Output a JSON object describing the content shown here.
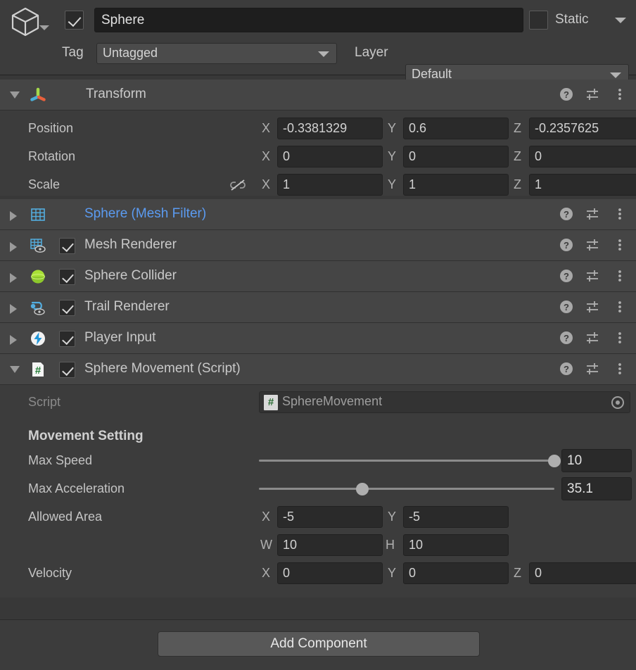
{
  "object_header": {
    "icon": "cube-icon",
    "enabled": true,
    "name": "Sphere",
    "static_enabled": false,
    "static_label": "Static",
    "tag_label": "Tag",
    "tag_value": "Untagged",
    "layer_label": "Layer",
    "layer_value": "Default"
  },
  "transform": {
    "title": "Transform",
    "icon": "transform-gizmo-icon",
    "expanded": true,
    "rows": [
      {
        "label": "Position",
        "x_label": "X",
        "x": "-0.3381329",
        "y_label": "Y",
        "y": "0.6",
        "z_label": "Z",
        "z": "-0.2357625"
      },
      {
        "label": "Rotation",
        "x_label": "X",
        "x": "0",
        "y_label": "Y",
        "y": "0",
        "z_label": "Z",
        "z": "0"
      },
      {
        "label": "Scale",
        "x_label": "X",
        "x": "1",
        "y_label": "Y",
        "y": "1",
        "z_label": "Z",
        "z": "1",
        "link": "broken-link-icon"
      }
    ]
  },
  "components": [
    {
      "title": "Sphere (Mesh Filter)",
      "icon": "mesh-filter-icon",
      "has_checkbox": false,
      "enabled": false,
      "expanded": false,
      "is_link": true
    },
    {
      "title": "Mesh Renderer",
      "icon": "mesh-renderer-icon",
      "has_checkbox": true,
      "enabled": true,
      "expanded": false,
      "is_link": false
    },
    {
      "title": "Sphere Collider",
      "icon": "sphere-collider-icon",
      "has_checkbox": true,
      "enabled": true,
      "expanded": false,
      "is_link": false
    },
    {
      "title": "Trail Renderer",
      "icon": "trail-renderer-icon",
      "has_checkbox": true,
      "enabled": true,
      "expanded": false,
      "is_link": false
    },
    {
      "title": "Player Input",
      "icon": "player-input-icon",
      "has_checkbox": true,
      "enabled": true,
      "expanded": false,
      "is_link": false
    },
    {
      "title": "Sphere Movement (Script)",
      "icon": "script-icon",
      "has_checkbox": true,
      "enabled": true,
      "expanded": true,
      "is_link": false
    }
  ],
  "script_component": {
    "script_row_label": "Script",
    "script_value": "SphereMovement",
    "script_icon_glyph": "#",
    "section_header": "Movement Setting",
    "max_speed": {
      "label": "Max Speed",
      "value": "10",
      "slider_percent": 100
    },
    "max_acceleration": {
      "label": "Max Acceleration",
      "value": "35.1",
      "slider_percent": 35
    },
    "allowed_area": {
      "label": "Allowed Area",
      "x_label": "X",
      "x": "-5",
      "y_label": "Y",
      "y": "-5",
      "w_label": "W",
      "w": "10",
      "h_label": "H",
      "h": "10"
    },
    "velocity": {
      "label": "Velocity",
      "x_label": "X",
      "x": "0",
      "y_label": "Y",
      "y": "0",
      "z_label": "Z",
      "z": "0"
    }
  },
  "footer": {
    "add_component_label": "Add Component"
  },
  "header_icons": {
    "help": "help-icon",
    "preset": "preset-icon",
    "menu": "kebab-menu-icon"
  },
  "colors": {
    "background": "#383838",
    "panel": "#3c3c3c",
    "component_header": "#454545",
    "field": "#2a2a2a",
    "link_text": "#5b9bf1",
    "text": "#c4c4c4",
    "button": "#585858"
  }
}
